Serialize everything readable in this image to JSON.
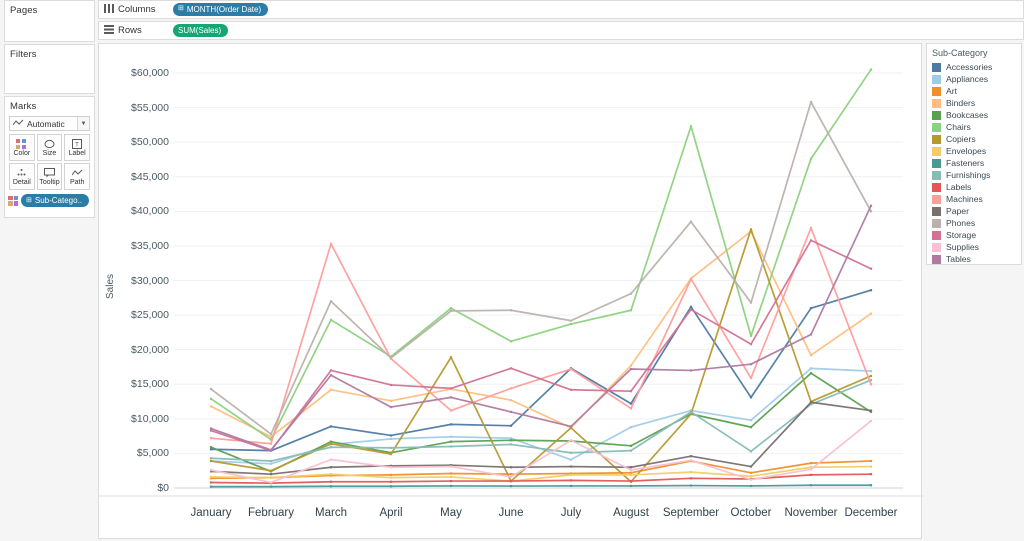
{
  "panels": {
    "pages": {
      "title": "Pages"
    },
    "filters": {
      "title": "Filters"
    },
    "marks": {
      "title": "Marks",
      "mark_type": "Automatic",
      "mark_type_icon": "line-chart-icon",
      "caret_icon": "chevron-down-icon",
      "buttons": [
        {
          "label": "Color",
          "icon": "color-palette-icon"
        },
        {
          "label": "Size",
          "icon": "size-icon"
        },
        {
          "label": "Label",
          "icon": "label-icon"
        },
        {
          "label": "Detail",
          "icon": "detail-icon"
        },
        {
          "label": "Tooltip",
          "icon": "tooltip-icon"
        },
        {
          "label": "Path",
          "icon": "path-icon"
        }
      ],
      "color_pill": {
        "label": "Sub-Catego..",
        "icon": "dimension-icon"
      }
    }
  },
  "shelves": {
    "columns": {
      "label": "Columns",
      "icon": "columns-icon",
      "pill": "MONTH(Order Date)",
      "pill_icon": "date-part-icon",
      "pill_color": "#2c7ca8"
    },
    "rows": {
      "label": "Rows",
      "icon": "rows-icon",
      "pill": "SUM(Sales)",
      "pill_color": "#17a673"
    }
  },
  "legend": {
    "title": "Sub-Category",
    "items": [
      {
        "label": "Accessories",
        "color": "#4e79a7"
      },
      {
        "label": "Appliances",
        "color": "#a0cbe8"
      },
      {
        "label": "Art",
        "color": "#f28e2b"
      },
      {
        "label": "Binders",
        "color": "#ffbe7d"
      },
      {
        "label": "Bookcases",
        "color": "#59a14f"
      },
      {
        "label": "Chairs",
        "color": "#8cd17d"
      },
      {
        "label": "Copiers",
        "color": "#b6992d"
      },
      {
        "label": "Envelopes",
        "color": "#f1ce63"
      },
      {
        "label": "Fasteners",
        "color": "#499894"
      },
      {
        "label": "Furnishings",
        "color": "#86bcb6"
      },
      {
        "label": "Labels",
        "color": "#e15759"
      },
      {
        "label": "Machines",
        "color": "#ff9d9a"
      },
      {
        "label": "Paper",
        "color": "#79706e"
      },
      {
        "label": "Phones",
        "color": "#bab0ac"
      },
      {
        "label": "Storage",
        "color": "#d37295"
      },
      {
        "label": "Supplies",
        "color": "#fabfd2"
      },
      {
        "label": "Tables",
        "color": "#b07aa1"
      }
    ]
  },
  "chart_data": {
    "type": "line",
    "title": "",
    "xlabel": "",
    "ylabel": "Sales",
    "ylim": [
      0,
      60000
    ],
    "yticks": [
      "$0",
      "$5,000",
      "$10,000",
      "$15,000",
      "$20,000",
      "$25,000",
      "$30,000",
      "$35,000",
      "$40,000",
      "$45,000",
      "$50,000",
      "$55,000",
      "$60,000"
    ],
    "ytick_values": [
      0,
      5000,
      10000,
      15000,
      20000,
      25000,
      30000,
      35000,
      40000,
      45000,
      50000,
      55000,
      60000
    ],
    "grid": true,
    "legend_position": "right",
    "categories": [
      "January",
      "February",
      "March",
      "April",
      "May",
      "June",
      "July",
      "August",
      "September",
      "October",
      "November",
      "December"
    ],
    "series": [
      {
        "name": "Accessories",
        "color": "#4e79a7",
        "values": [
          5600,
          5400,
          8900,
          7600,
          9200,
          9000,
          17300,
          12200,
          26200,
          13100,
          26000,
          28600
        ]
      },
      {
        "name": "Appliances",
        "color": "#a0cbe8",
        "values": [
          3900,
          3500,
          6300,
          7100,
          7400,
          7200,
          4100,
          8800,
          11200,
          9800,
          17300,
          16900
        ]
      },
      {
        "name": "Art",
        "color": "#f28e2b",
        "values": [
          1400,
          1500,
          1800,
          1900,
          2100,
          2000,
          2100,
          2200,
          3900,
          2200,
          3600,
          3900
        ]
      },
      {
        "name": "Binders",
        "color": "#ffbe7d",
        "values": [
          11800,
          7400,
          14200,
          12600,
          14300,
          12700,
          8700,
          17700,
          30300,
          37100,
          19200,
          25200
        ]
      },
      {
        "name": "Bookcases",
        "color": "#59a14f",
        "values": [
          5900,
          2400,
          6700,
          5100,
          6700,
          6900,
          6800,
          6100,
          10700,
          8800,
          16600,
          11000
        ]
      },
      {
        "name": "Chairs",
        "color": "#8cd17d",
        "values": [
          12900,
          7000,
          24300,
          19000,
          26000,
          21200,
          23700,
          25700,
          52300,
          22000,
          47600,
          60500
        ]
      },
      {
        "name": "Copiers",
        "color": "#b6992d",
        "values": [
          3900,
          2500,
          6400,
          4900,
          18900,
          1000,
          8700,
          900,
          10700,
          37400,
          12500,
          16200
        ]
      },
      {
        "name": "Envelopes",
        "color": "#f1ce63",
        "values": [
          1600,
          1500,
          2000,
          1500,
          1600,
          1000,
          1900,
          1900,
          2300,
          1700,
          3000,
          3100
        ]
      },
      {
        "name": "Fasteners",
        "color": "#499894",
        "values": [
          200,
          200,
          250,
          250,
          300,
          280,
          300,
          300,
          350,
          300,
          400,
          400
        ]
      },
      {
        "name": "Furnishings",
        "color": "#86bcb6",
        "values": [
          4300,
          3900,
          5900,
          5800,
          6000,
          6300,
          5100,
          5400,
          11000,
          5300,
          12100,
          15600
        ]
      },
      {
        "name": "Labels",
        "color": "#e15759",
        "values": [
          800,
          700,
          900,
          900,
          1000,
          1000,
          1100,
          1000,
          1400,
          1300,
          1900,
          2000
        ]
      },
      {
        "name": "Machines",
        "color": "#ff9d9a",
        "values": [
          7200,
          6400,
          35300,
          18700,
          11200,
          14400,
          17200,
          11500,
          30200,
          15900,
          37600,
          15000
        ]
      },
      {
        "name": "Paper",
        "color": "#79706e",
        "values": [
          2400,
          2000,
          3000,
          3200,
          3300,
          3000,
          3100,
          3000,
          4600,
          3100,
          12400,
          11200
        ]
      },
      {
        "name": "Phones",
        "color": "#bab0ac",
        "values": [
          14300,
          7800,
          27000,
          18800,
          25600,
          25700,
          24200,
          28100,
          38500,
          26800,
          55800,
          40000
        ]
      },
      {
        "name": "Storage",
        "color": "#d37295",
        "values": [
          8300,
          5400,
          17000,
          14900,
          14400,
          17300,
          14200,
          14000,
          25800,
          20800,
          35800,
          31700
        ]
      },
      {
        "name": "Supplies",
        "color": "#fabfd2",
        "values": [
          2600,
          800,
          4100,
          3000,
          3100,
          1600,
          6900,
          2600,
          4000,
          1200,
          2700,
          9700
        ]
      },
      {
        "name": "Tables",
        "color": "#b07aa1",
        "values": [
          8600,
          5500,
          16300,
          11700,
          13100,
          11000,
          8900,
          17200,
          17000,
          17900,
          22200,
          40800
        ]
      }
    ]
  }
}
